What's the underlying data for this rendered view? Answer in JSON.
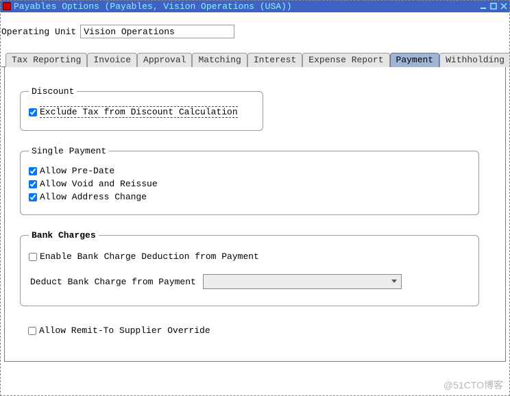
{
  "window": {
    "title": "Payables Options (Payables, Vision Operations (USA))"
  },
  "operating_unit": {
    "label": "Operating Unit",
    "value": "Vision Operations"
  },
  "tabs": [
    {
      "label": "Tax Reporting",
      "active": false
    },
    {
      "label": "Invoice",
      "active": false
    },
    {
      "label": "Approval",
      "active": false
    },
    {
      "label": "Matching",
      "active": false
    },
    {
      "label": "Interest",
      "active": false
    },
    {
      "label": "Expense Report",
      "active": false
    },
    {
      "label": "Payment",
      "active": true
    },
    {
      "label": "Withholding Tax",
      "active": false
    }
  ],
  "groups": {
    "discount": {
      "legend": "Discount",
      "exclude_tax": {
        "label": "Exclude Tax from Discount Calculation",
        "checked": true
      }
    },
    "single_payment": {
      "legend": "Single Payment",
      "allow_pre_date": {
        "label": "Allow Pre-Date",
        "checked": true
      },
      "allow_void_reissue": {
        "label": "Allow Void and Reissue",
        "checked": true
      },
      "allow_address_change": {
        "label": "Allow Address Change",
        "checked": true
      }
    },
    "bank_charges": {
      "legend": "Bank Charges",
      "enable_deduction": {
        "label": "Enable Bank Charge Deduction from Payment",
        "checked": false
      },
      "deduct_label": "Deduct Bank Charge from Payment",
      "deduct_value": ""
    }
  },
  "allow_remit_to": {
    "label": "Allow Remit-To Supplier Override",
    "checked": false
  },
  "watermark": "@51CTO博客"
}
